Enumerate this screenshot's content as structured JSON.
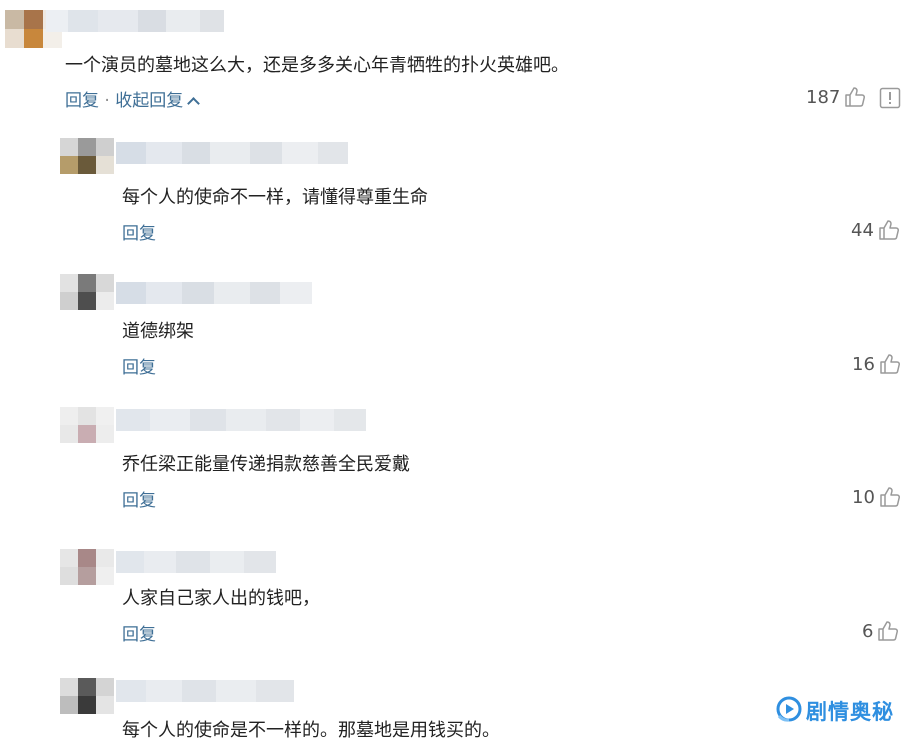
{
  "main_comment": {
    "text": "一个演员的墓地这么大，还是多多关心年青牺牲的扑火英雄吧。",
    "reply_label": "回复",
    "separator": "·",
    "collapse_label": "收起回复",
    "likes": "187"
  },
  "replies": [
    {
      "text": "每个人的使命不一样，请懂得尊重生命",
      "reply_label": "回复",
      "likes": "44"
    },
    {
      "text": "道德绑架",
      "reply_label": "回复",
      "likes": "16"
    },
    {
      "text": "乔任梁正能量传递捐款慈善全民爱戴",
      "reply_label": "回复",
      "likes": "10"
    },
    {
      "text": "人家自己家人出的钱吧，",
      "reply_label": "回复",
      "likes": "6"
    },
    {
      "text": "每个人的使命是不一样的。那墓地是用钱买的。"
    }
  ],
  "watermark": {
    "text": "剧情奥秘"
  },
  "colors": {
    "link": "#3f6f96",
    "text": "#222222",
    "count": "#555555",
    "watermark": "#2f8fe0"
  },
  "icons": [
    "thumbs-up-icon",
    "report-icon",
    "chevron-up-icon",
    "watermark-logo-icon"
  ]
}
